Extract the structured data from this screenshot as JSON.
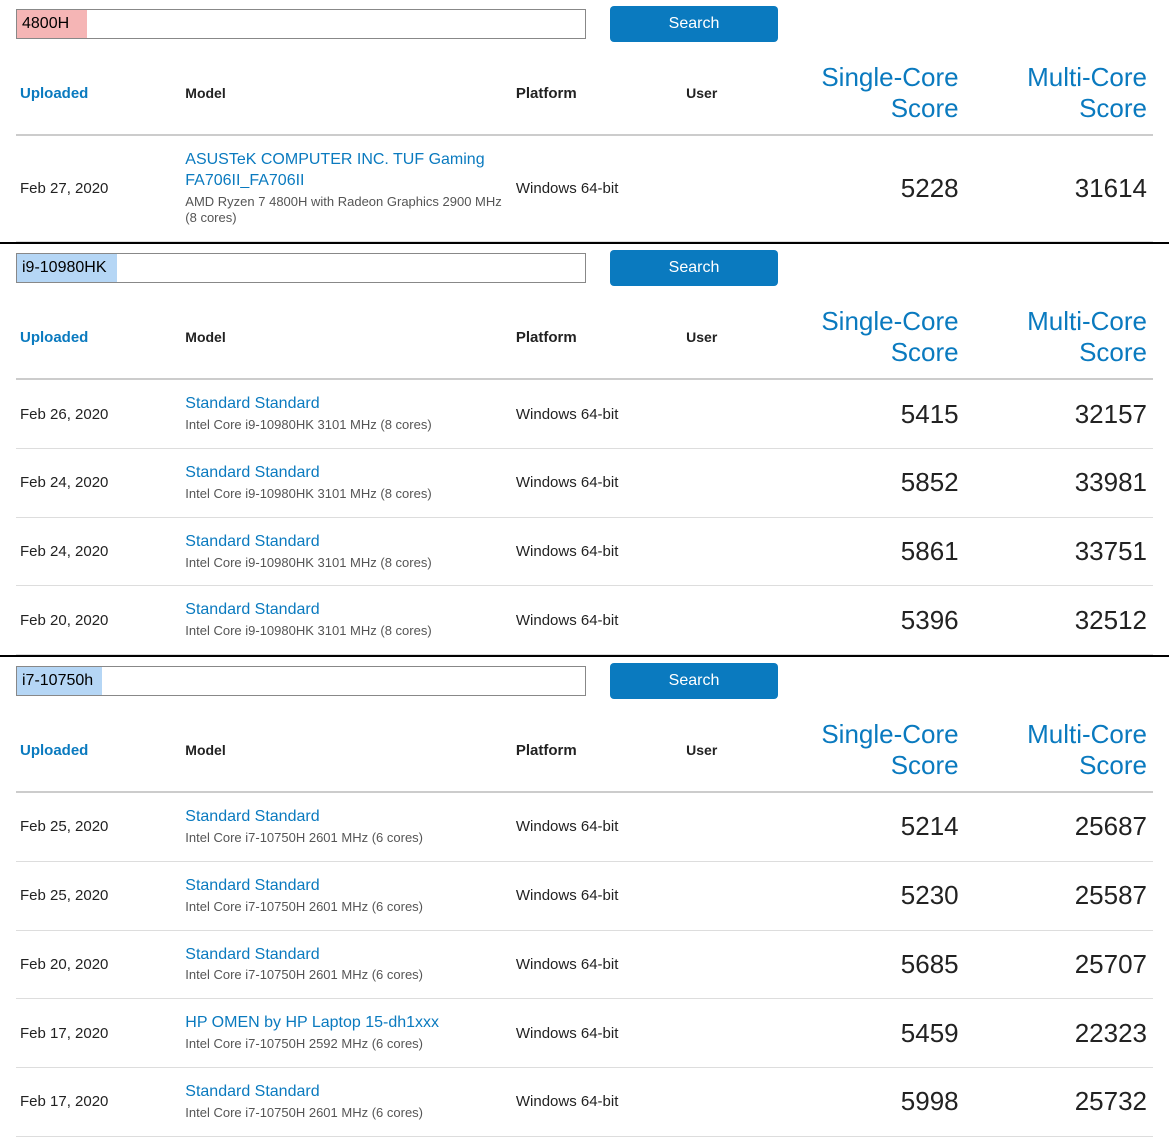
{
  "columns": {
    "uploaded": "Uploaded",
    "model": "Model",
    "platform": "Platform",
    "user": "User",
    "single": "Single-Core Score",
    "multi": "Multi-Core Score"
  },
  "search_button_label": "Search",
  "sections": [
    {
      "query": "4800H",
      "highlight": "pink",
      "rows": [
        {
          "uploaded": "Feb 27, 2020",
          "model_link": "ASUSTeK COMPUTER INC. TUF Gaming FA706II_FA706II",
          "model_sub": "AMD Ryzen 7 4800H with Radeon Graphics 2900 MHz (8 cores)",
          "platform": "Windows 64-bit",
          "user": "",
          "single": "5228",
          "multi": "31614"
        }
      ]
    },
    {
      "query": "i9-10980HK",
      "highlight": "blue",
      "rows": [
        {
          "uploaded": "Feb 26, 2020",
          "model_link": "Standard Standard",
          "model_sub": "Intel Core i9-10980HK 3101 MHz (8 cores)",
          "platform": "Windows 64-bit",
          "user": "",
          "single": "5415",
          "multi": "32157"
        },
        {
          "uploaded": "Feb 24, 2020",
          "model_link": "Standard Standard",
          "model_sub": "Intel Core i9-10980HK 3101 MHz (8 cores)",
          "platform": "Windows 64-bit",
          "user": "",
          "single": "5852",
          "multi": "33981"
        },
        {
          "uploaded": "Feb 24, 2020",
          "model_link": "Standard Standard",
          "model_sub": "Intel Core i9-10980HK 3101 MHz (8 cores)",
          "platform": "Windows 64-bit",
          "user": "",
          "single": "5861",
          "multi": "33751"
        },
        {
          "uploaded": "Feb 20, 2020",
          "model_link": "Standard Standard",
          "model_sub": "Intel Core i9-10980HK 3101 MHz (8 cores)",
          "platform": "Windows 64-bit",
          "user": "",
          "single": "5396",
          "multi": "32512"
        }
      ]
    },
    {
      "query": "i7-10750h",
      "highlight": "i7",
      "rows": [
        {
          "uploaded": "Feb 25, 2020",
          "model_link": "Standard Standard",
          "model_sub": "Intel Core i7-10750H 2601 MHz (6 cores)",
          "platform": "Windows 64-bit",
          "user": "",
          "single": "5214",
          "multi": "25687"
        },
        {
          "uploaded": "Feb 25, 2020",
          "model_link": "Standard Standard",
          "model_sub": "Intel Core i7-10750H 2601 MHz (6 cores)",
          "platform": "Windows 64-bit",
          "user": "",
          "single": "5230",
          "multi": "25587"
        },
        {
          "uploaded": "Feb 20, 2020",
          "model_link": "Standard Standard",
          "model_sub": "Intel Core i7-10750H 2601 MHz (6 cores)",
          "platform": "Windows 64-bit",
          "user": "",
          "single": "5685",
          "multi": "25707"
        },
        {
          "uploaded": "Feb 17, 2020",
          "model_link": "HP OMEN by HP Laptop 15-dh1xxx",
          "model_sub": "Intel Core i7-10750H 2592 MHz (6 cores)",
          "platform": "Windows 64-bit",
          "user": "",
          "single": "5459",
          "multi": "22323"
        },
        {
          "uploaded": "Feb 17, 2020",
          "model_link": "Standard Standard",
          "model_sub": "Intel Core i7-10750H 2601 MHz (6 cores)",
          "platform": "Windows 64-bit",
          "user": "",
          "single": "5998",
          "multi": "25732"
        }
      ]
    }
  ]
}
